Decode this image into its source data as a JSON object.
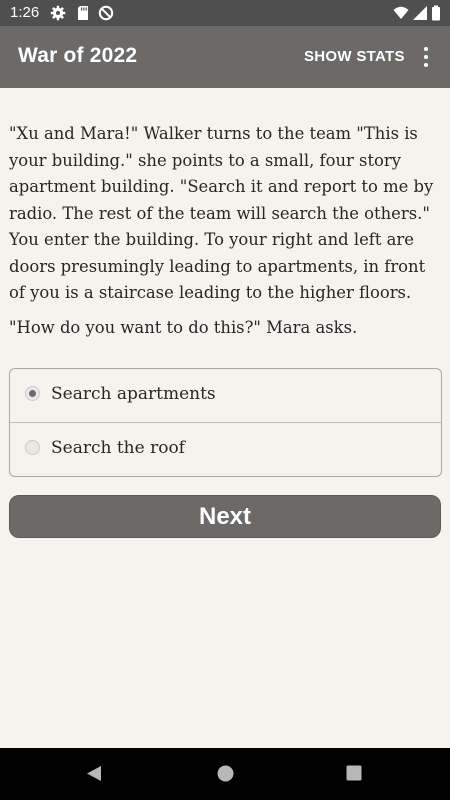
{
  "status_bar": {
    "time": "1:26",
    "left_icons": [
      "settings-icon",
      "sd-card-icon",
      "do-not-disturb-icon"
    ],
    "right_icons": [
      "wifi-icon",
      "signal-icon",
      "battery-icon"
    ]
  },
  "app_bar": {
    "title": "War of 2022",
    "show_stats_label": "SHOW STATS",
    "overflow_icon": "more-vert-icon"
  },
  "story": {
    "paragraph": "\"Xu and Mara!\" Walker turns to the team \"This is your building.\" she points to a small, four story apartment building. \"Search it and report to me by radio. The rest of the team will search the others.\" You enter the building. To your right and left are doors presumingly leading to apartments, in front of you is a staircase leading to the higher floors.",
    "question": "\"How do you want to do this?\" Mara asks."
  },
  "choices": [
    {
      "label": "Search apartments",
      "selected": true
    },
    {
      "label": "Search the roof",
      "selected": false
    }
  ],
  "next_button": {
    "label": "Next"
  },
  "nav_bar": {
    "icons": [
      "back-icon",
      "home-icon",
      "recents-icon"
    ]
  },
  "colors": {
    "app_bar": "#6b6a68",
    "status_bar": "#4f4f4f",
    "background": "#f6f3ef",
    "button": "#6b6a68"
  }
}
